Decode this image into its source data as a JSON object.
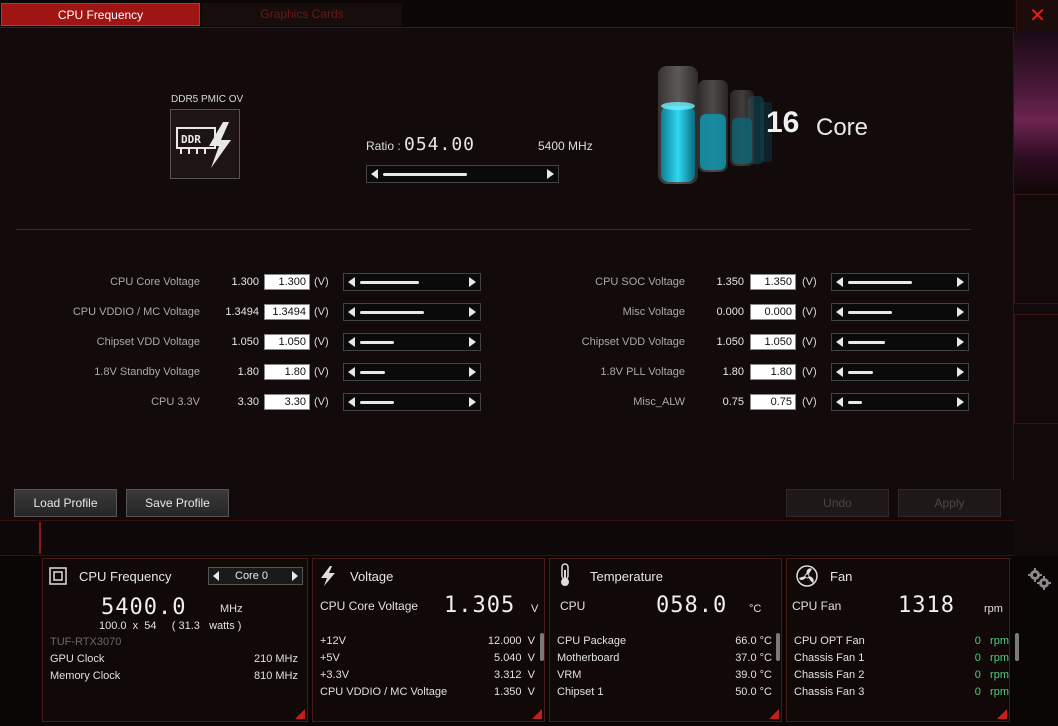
{
  "tabs": {
    "cpu_frequency": "CPU Frequency",
    "graphics_cards": "Graphics Cards"
  },
  "window": {
    "close_symbol": "✕"
  },
  "ddr": {
    "label": "DDR5 PMIC OV",
    "icon_text": "DDR"
  },
  "ratio": {
    "label": "Ratio :",
    "value": "054.00",
    "mhz": "5400 MHz",
    "position": 0.55
  },
  "cores": {
    "count": "16",
    "word": "Core"
  },
  "voltages_left": [
    {
      "label": "CPU Core Voltage",
      "current": "1.300",
      "input": "1.300",
      "unit": "(V)",
      "position": 0.6
    },
    {
      "label": "CPU VDDIO / MC Voltage",
      "current": "1.3494",
      "input": "1.3494",
      "unit": "(V)",
      "position": 0.65
    },
    {
      "label": "Chipset VDD Voltage",
      "current": "1.050",
      "input": "1.050",
      "unit": "(V)",
      "position": 0.35
    },
    {
      "label": "1.8V Standby Voltage",
      "current": "1.80",
      "input": "1.80",
      "unit": "(V)",
      "position": 0.25
    },
    {
      "label": "CPU 3.3V",
      "current": "3.30",
      "input": "3.30",
      "unit": "(V)",
      "position": 0.35
    }
  ],
  "voltages_right": [
    {
      "label": "CPU SOC Voltage",
      "current": "1.350",
      "input": "1.350",
      "unit": "(V)",
      "position": 0.65
    },
    {
      "label": "Misc Voltage",
      "current": "0.000",
      "input": "0.000",
      "unit": "(V)",
      "position": 0.45
    },
    {
      "label": "Chipset VDD Voltage",
      "current": "1.050",
      "input": "1.050",
      "unit": "(V)",
      "position": 0.38
    },
    {
      "label": "1.8V PLL Voltage",
      "current": "1.80",
      "input": "1.80",
      "unit": "(V)",
      "position": 0.25
    },
    {
      "label": "Misc_ALW",
      "current": "0.75",
      "input": "0.75",
      "unit": "(V)",
      "position": 0.14
    }
  ],
  "buttons": {
    "load_profile": "Load Profile",
    "save_profile": "Save Profile",
    "undo": "Undo",
    "apply": "Apply"
  },
  "monitor": {
    "cpu": {
      "title": "CPU Frequency",
      "core_select": "Core 0",
      "value": "5400.0",
      "unit": "MHz",
      "formula": "100.0  x  54     ( 31.3   watts )",
      "gpu_name": "TUF-RTX3070",
      "rows": [
        {
          "label": "GPU Clock",
          "value": "210 MHz"
        },
        {
          "label": "Memory Clock",
          "value": "810 MHz"
        }
      ]
    },
    "voltage": {
      "title": "Voltage",
      "main_label": "CPU Core Voltage",
      "value": "1.305",
      "unit": "V",
      "rows": [
        {
          "label": "+12V",
          "value": "12.000  V"
        },
        {
          "label": "+5V",
          "value": "5.040  V"
        },
        {
          "label": "+3.3V",
          "value": "3.312  V"
        },
        {
          "label": "CPU VDDIO / MC Voltage",
          "value": "1.350  V"
        }
      ]
    },
    "temperature": {
      "title": "Temperature",
      "main_label": "CPU",
      "value": "058.0",
      "unit": "°C",
      "rows": [
        {
          "label": "CPU Package",
          "value": "66.0 °C"
        },
        {
          "label": "Motherboard",
          "value": "37.0 °C"
        },
        {
          "label": "VRM",
          "value": "39.0 °C"
        },
        {
          "label": "Chipset 1",
          "value": "50.0 °C"
        }
      ]
    },
    "fan": {
      "title": "Fan",
      "main_label": "CPU Fan",
      "value": "1318",
      "unit": "rpm",
      "rows": [
        {
          "label": "CPU OPT Fan",
          "value": "0   rpm"
        },
        {
          "label": "Chassis Fan 1",
          "value": "0   rpm"
        },
        {
          "label": "Chassis Fan 2",
          "value": "0   rpm"
        },
        {
          "label": "Chassis Fan 3",
          "value": "0   rpm"
        }
      ]
    }
  },
  "colors": {
    "accent_red": "#a01414",
    "fan_green": "#4fcf7a",
    "liquid_cyan": "#19c3de"
  }
}
